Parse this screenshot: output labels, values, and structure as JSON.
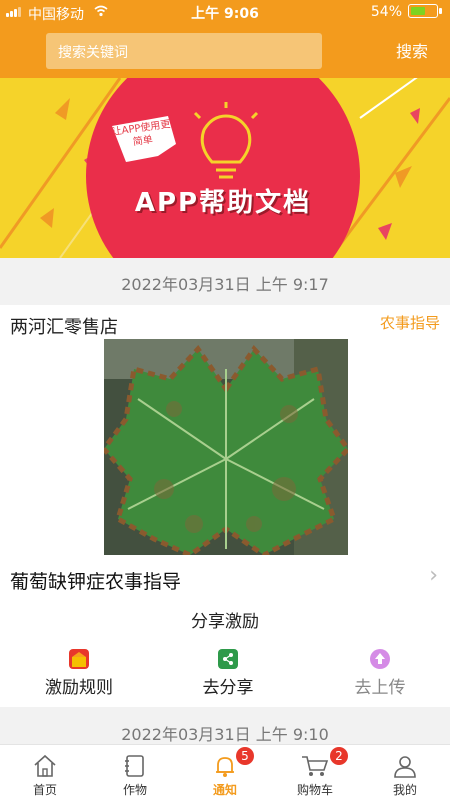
{
  "status": {
    "carrier": "中国移动",
    "time": "上午 9:06",
    "battery": "54%"
  },
  "header": {
    "search_placeholder": "搜索关键词",
    "search_label": "搜索"
  },
  "banner": {
    "title": "APP帮助文档",
    "badge": "让APP使用更简单"
  },
  "feed": {
    "timestamp_1": "2022年03月31日 上午 9:17",
    "post": {
      "shop": "两河汇零售店",
      "tag": "农事指导",
      "title": "葡萄缺钾症农事指导",
      "share_title": "分享激励",
      "actions": [
        {
          "label": "激励规则",
          "icon": "gift-icon"
        },
        {
          "label": "去分享",
          "icon": "share-icon"
        },
        {
          "label": "去上传",
          "icon": "upload-icon"
        }
      ]
    },
    "timestamp_2": "2022年03月31日 上午 9:10"
  },
  "nav": [
    {
      "label": "首页",
      "icon": "home-icon"
    },
    {
      "label": "作物",
      "icon": "notebook-icon"
    },
    {
      "label": "通知",
      "icon": "bell-icon",
      "badge": "5"
    },
    {
      "label": "购物车",
      "icon": "cart-icon",
      "badge": "2"
    },
    {
      "label": "我的",
      "icon": "person-icon"
    }
  ],
  "colors": {
    "accent": "#f39b1d",
    "badge": "#e8372b",
    "banner_bg": "#f5d32a",
    "banner_circle": "#ea2e4a"
  }
}
